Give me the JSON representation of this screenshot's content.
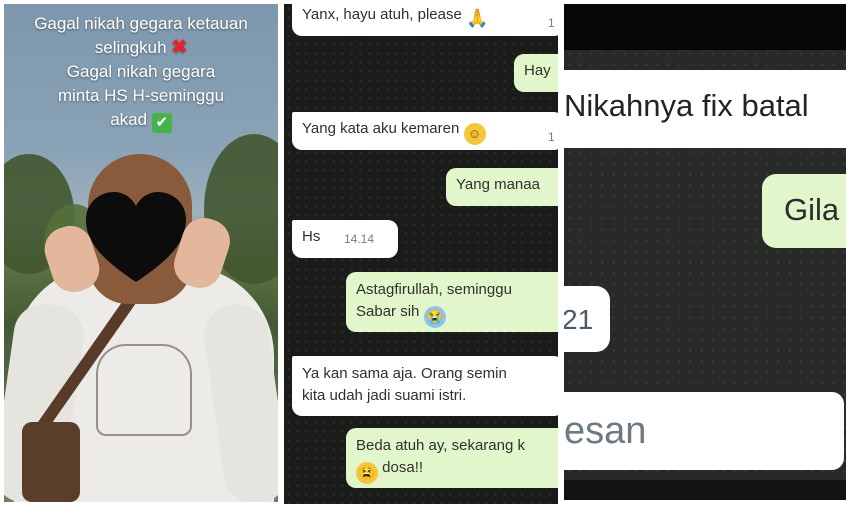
{
  "story": {
    "line1": "Gagal nikah gegara ketauan",
    "line2": "selingkuh",
    "line3": "Gagal nikah gegara",
    "line4": "minta HS H-seminggu",
    "line5": "akad",
    "cross_mark": "✖",
    "check_mark": "✔"
  },
  "chat": {
    "messages": [
      {
        "side": "in",
        "text": "Yanx, hayu atuh, please",
        "emoji": "pray-emoji",
        "time": "1"
      },
      {
        "side": "out",
        "text": "Hay"
      },
      {
        "side": "in",
        "text": "Yang kata aku kemaren",
        "emoji": "smiling-face-with-halo-emoji",
        "time": "1"
      },
      {
        "side": "out",
        "text": "Yang manaa"
      },
      {
        "side": "in",
        "text": "Hs",
        "time": "14.14"
      },
      {
        "side": "out",
        "line1": "Astagfirullah, seminggu",
        "line2": "Sabar sih",
        "emoji": "crying-face-emoji"
      },
      {
        "side": "in",
        "line1": "Ya kan sama aja. Orang semin",
        "line2": "kita udah jadi suami istri."
      },
      {
        "side": "out",
        "line1": "Beda atuh ay, sekarang k",
        "line2": "dosa!!",
        "emoji": "weary-face-emoji"
      }
    ]
  },
  "zoom": {
    "headline": "Nikahnya fix batal",
    "reply": "Gila",
    "time_fragment": "21",
    "input_placeholder": "esan"
  },
  "colors": {
    "chat_incoming": "#ffffff",
    "chat_outgoing": "#e2f6cc",
    "chat_background": "#1a1c19",
    "cross": "#e3262e",
    "check": "#43b34a"
  }
}
